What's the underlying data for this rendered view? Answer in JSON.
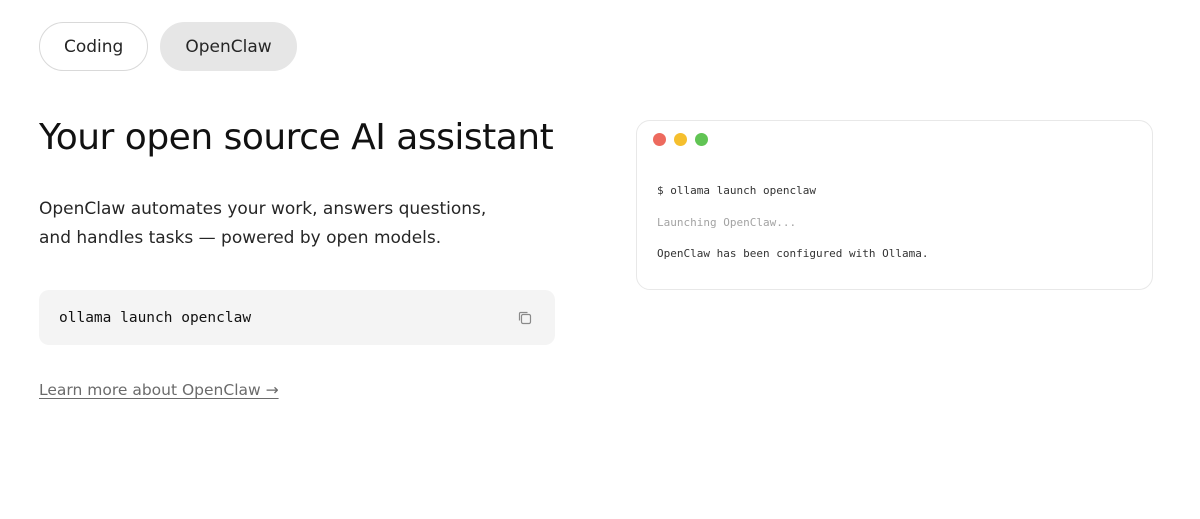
{
  "tabs": [
    {
      "label": "Coding",
      "active": false
    },
    {
      "label": "OpenClaw",
      "active": true
    }
  ],
  "hero": {
    "title": "Your open source AI assistant",
    "description": "OpenClaw automates your work, answers questions, and handles tasks — powered by open models."
  },
  "command": {
    "text": "ollama launch openclaw",
    "copy_icon": "copy-icon"
  },
  "learn_more": {
    "label": "Learn more about OpenClaw →"
  },
  "terminal": {
    "dots": [
      {
        "name": "close-dot",
        "color": "#ed6a5e"
      },
      {
        "name": "minimize-dot",
        "color": "#f5bf2e"
      },
      {
        "name": "maximize-dot",
        "color": "#61c454"
      }
    ],
    "lines": [
      "$ ollama launch openclaw",
      "Launching OpenClaw...",
      "OpenClaw has been configured with Ollama."
    ]
  },
  "colors": {
    "active_tab_bg": "#e6e6e6",
    "command_bg": "#f4f4f4",
    "muted_text": "#a3a3a3",
    "link_text": "#6b6b6b"
  }
}
